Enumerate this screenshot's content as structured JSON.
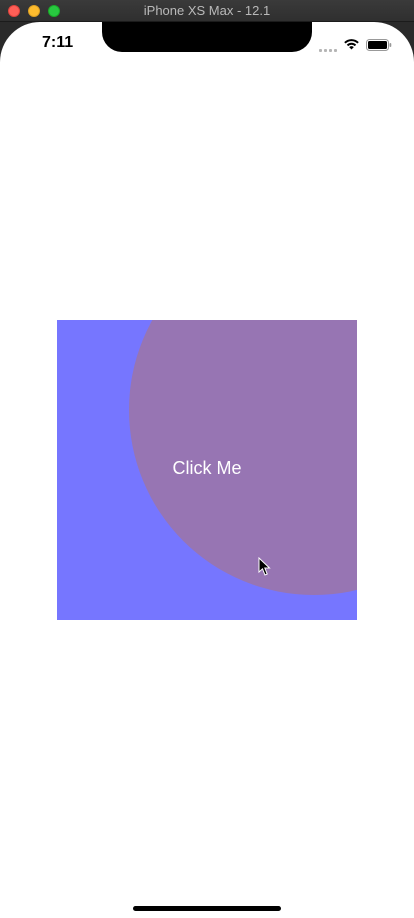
{
  "window": {
    "title": "iPhone XS Max - 12.1"
  },
  "status_bar": {
    "time": "7:11"
  },
  "demo": {
    "button_label": "Click Me",
    "background_color": "#7676ff",
    "ripple_color": "#9775b3"
  },
  "icons": {
    "close": "close-icon",
    "minimize": "minimize-icon",
    "maximize": "maximize-icon",
    "signal": "signal-icon",
    "wifi": "wifi-icon",
    "battery": "battery-icon",
    "cursor": "cursor-icon"
  }
}
